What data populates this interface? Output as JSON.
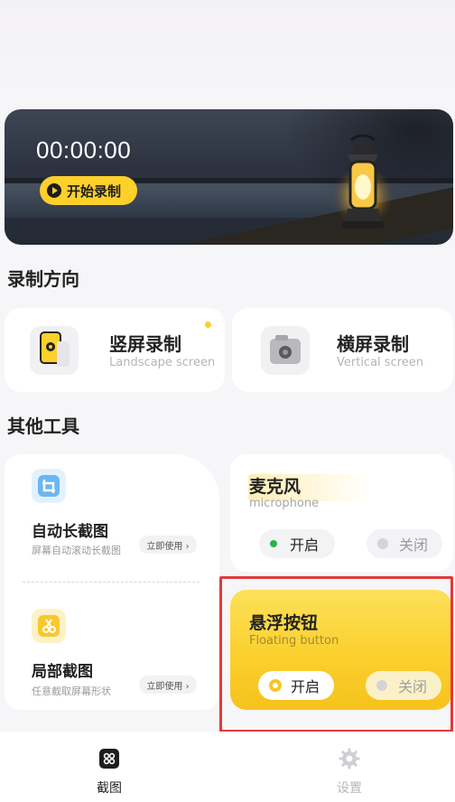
{
  "banner": {
    "timer": "00:00:00",
    "start_label": "开始录制"
  },
  "orientation": {
    "section_title": "录制方向",
    "portrait": {
      "title": "竖屏录制",
      "subtitle": "Landscape screen"
    },
    "landscape": {
      "title": "横屏录制",
      "subtitle": "Vertical screen"
    }
  },
  "tools": {
    "section_title": "其他工具",
    "long_screenshot": {
      "title": "自动长截图",
      "desc": "屏幕自动滚动长截图",
      "action": "立即使用 ›"
    },
    "partial_screenshot": {
      "title": "局部截图",
      "desc": "任意截取屏幕形状",
      "action": "立即使用 ›"
    },
    "microphone": {
      "title": "麦克风",
      "subtitle": "microphone",
      "on_label": "开启",
      "off_label": "关闭"
    },
    "floating_button": {
      "title": "悬浮按钮",
      "subtitle": "Floating button",
      "on_label": "开启",
      "off_label": "关闭"
    }
  },
  "nav": {
    "items": [
      {
        "label": "截图",
        "active": true
      },
      {
        "label": "设置",
        "active": false
      }
    ]
  },
  "colors": {
    "accent": "#fdd02a",
    "green_dot": "#2bb34b",
    "highlight_frame": "#e03b3b"
  }
}
